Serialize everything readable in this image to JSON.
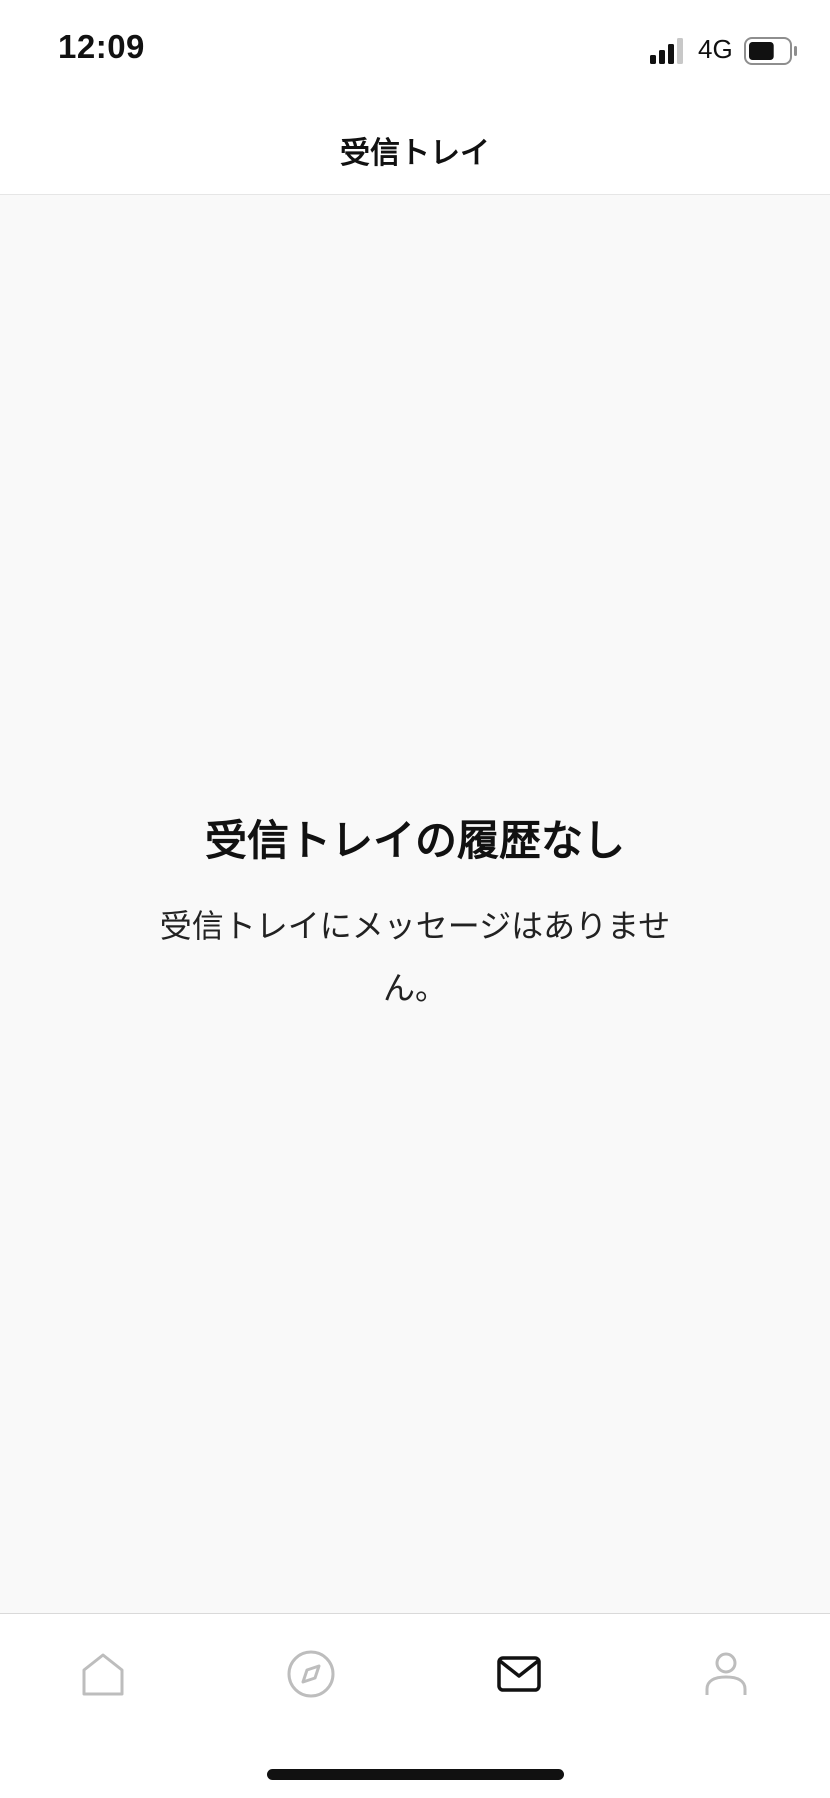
{
  "status_bar": {
    "time": "12:09",
    "network": "4G",
    "signal_icon": "signal-bars-icon",
    "battery_icon": "battery-icon",
    "battery_level": 0.65
  },
  "nav": {
    "title": "受信トレイ"
  },
  "empty_state": {
    "title": "受信トレイの履歴なし",
    "message": "受信トレイにメッセージはありません。"
  },
  "tab_bar": {
    "tabs": [
      {
        "icon": "home-icon",
        "active": false
      },
      {
        "icon": "compass-icon",
        "active": false
      },
      {
        "icon": "mail-icon",
        "active": true
      },
      {
        "icon": "profile-icon",
        "active": false
      }
    ],
    "active_color": "#111111",
    "inactive_color": "#bdbdbd"
  }
}
